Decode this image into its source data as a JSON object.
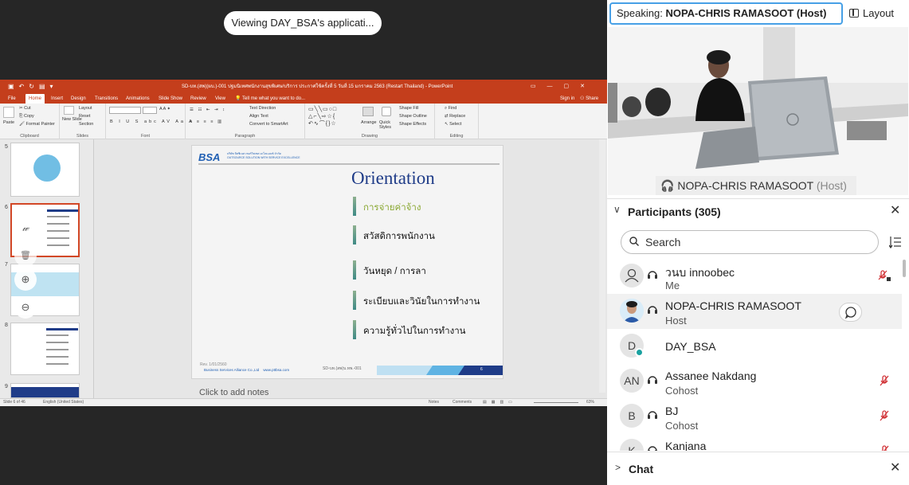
{
  "share": {
    "viewing_label": "Viewing DAY_BSA's applicati...",
    "ppt": {
      "window_title": "SD-บท.(สพ)(ผบ.)-001 ปฐมนิเทศพนักงานสุขพิเศษ/บริการ ประกาศใช้ครั้งที่ 5 วันที่ 15 มกราคม 2563  (Restart Thailand) - PowerPoint",
      "tabs": [
        "File",
        "Home",
        "Insert",
        "Design",
        "Transitions",
        "Animations",
        "Slide Show",
        "Review",
        "View"
      ],
      "tell_me": "Tell me what you want to do...",
      "signin": "Sign in",
      "share": "Share",
      "ribbon": {
        "clipboard": {
          "label": "Clipboard",
          "paste": "Paste",
          "cut": "Cut",
          "copy": "Copy",
          "format_painter": "Format Painter"
        },
        "slides": {
          "label": "Slides",
          "new_slide": "New Slide",
          "layout": "Layout",
          "reset": "Reset",
          "section": "Section"
        },
        "font": {
          "label": "Font"
        },
        "paragraph": {
          "label": "Paragraph",
          "text_direction": "Text Direction",
          "align_text": "Align Text",
          "convert_smartart": "Convert to SmartArt"
        },
        "drawing": {
          "label": "Drawing",
          "arrange": "Arrange",
          "quick_styles": "Quick Styles",
          "shape_fill": "Shape Fill",
          "shape_outline": "Shape Outline",
          "shape_effects": "Shape Effects"
        },
        "editing": {
          "label": "Editing",
          "find": "Find",
          "replace": "Replace",
          "select": "Select"
        }
      },
      "thumb_numbers": [
        "5",
        "6",
        "7",
        "8",
        "9"
      ],
      "slide": {
        "logo": "BSA",
        "logo_sub_1": "บริษัท บิสซิเนส เซอร์วิสเซส อะไลแอนซ์ จำกัด",
        "logo_sub_2": "OUTSOURCE SOLUTION WITH SERVICE EXCELLENCE",
        "title": "Orientation",
        "bullets": [
          "การจ่ายค่าจ้าง",
          "สวัสดิการพนักงาน",
          "วันหยุด / การลา",
          "ระเบียบและวินัยในการทำงาน",
          "ความรู้ทั่วไปในการทำงาน"
        ],
        "footer_rev": "Rev. 1/01/2560",
        "footer_company": "Business Services Alliance Co.,Ltd",
        "footer_url": "www.pttbsa.com",
        "footer_code": "SD-บท.(สพ)บ.ทพ.-001",
        "page_num": "6"
      },
      "notes_placeholder": "Click to add notes",
      "status": {
        "slide_of": "Slide 6 of 46",
        "language": "English (United States)",
        "notes": "Notes",
        "comments": "Comments",
        "zoom": "63%"
      }
    }
  },
  "panel": {
    "speaking_prefix": "Speaking:",
    "speaking_name": "NOPA-CHRIS RAMASOOT (Host)",
    "layout_label": "Layout",
    "video_name": "NOPA-CHRIS RAMASOOT",
    "video_role": "(Host)",
    "participants_title": "Participants (305)",
    "search_placeholder": "Search",
    "participants": [
      {
        "initials": "",
        "name": "วนบ innoobec",
        "role": "Me"
      },
      {
        "initials": "",
        "name": "NOPA-CHRIS RAMASOOT",
        "role": "Host"
      },
      {
        "initials": "D",
        "name": "DAY_BSA",
        "role": ""
      },
      {
        "initials": "AN",
        "name": "Assanee Nakdang",
        "role": "Cohost"
      },
      {
        "initials": "B",
        "name": "BJ",
        "role": "Cohost"
      },
      {
        "initials": "K",
        "name": "Kanjana",
        "role": ""
      }
    ],
    "chat_title": "Chat"
  },
  "colors": {
    "ppt_red": "#c43e1c",
    "accent_blue": "#47a0e6",
    "mute_red": "#d13438",
    "slide_title_blue": "#1f3c88"
  }
}
